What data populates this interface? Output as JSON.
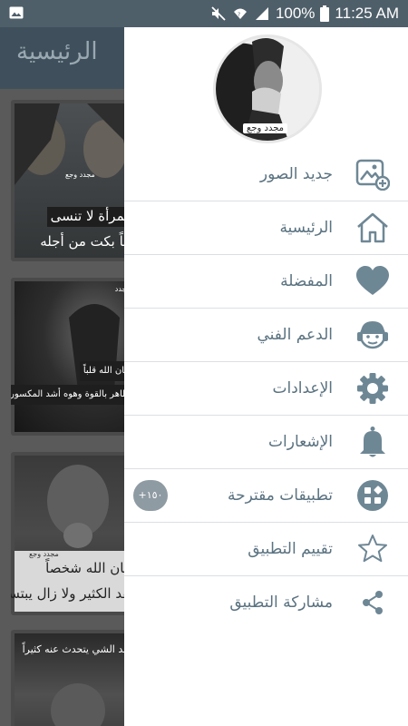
{
  "status_bar": {
    "percent": "100%",
    "time": "11:25 AM"
  },
  "app": {
    "title": "الرئيسية"
  },
  "cards": [
    {
      "line1": "المرأة لا تنسى",
      "line2": "حباً بكت من أجله",
      "mark": "مجدد وجع"
    },
    {
      "line1": "أعان الله قلباً",
      "line2": "تظاهر بالقوة وهوه أشد المكسورين",
      "mark": "مجدد"
    },
    {
      "line1": "اعان الله شخصاً",
      "line2": "فقد الكثير ولا زال يبتسم",
      "mark": "مجدد وجع"
    },
    {
      "line1": "فاقد الشي يتحدث عنه كثيراً",
      "line2": "",
      "mark": ""
    }
  ],
  "drawer": {
    "avatar_label": "مجدد وجع",
    "menu": [
      {
        "label": "جديد الصور",
        "icon": "image-add-icon"
      },
      {
        "label": "الرئيسية",
        "icon": "home-icon"
      },
      {
        "label": "المفضلة",
        "icon": "heart-icon"
      },
      {
        "label": "الدعم الفني",
        "icon": "support-icon"
      },
      {
        "label": "الإعدادات",
        "icon": "gear-icon"
      },
      {
        "label": "الإشعارات",
        "icon": "bell-icon"
      },
      {
        "label": "تطبيقات مقترحة",
        "icon": "apps-icon",
        "badge": "+١٥٠"
      },
      {
        "label": "تقييم التطبيق",
        "icon": "star-icon"
      },
      {
        "label": "مشاركة التطبيق",
        "icon": "share-icon"
      }
    ]
  },
  "colors": {
    "accent": "#5a7280",
    "status_bar": "#4f5f6a",
    "badge": "#8f9ba3"
  }
}
